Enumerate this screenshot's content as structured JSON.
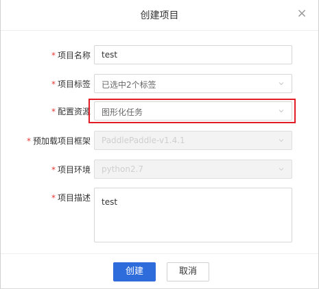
{
  "dialog": {
    "title": "创建项目",
    "close_icon": "close-icon",
    "close_glyph": "×"
  },
  "form": {
    "required_mark": "*",
    "name": {
      "label": "项目名称",
      "value": "test"
    },
    "tags": {
      "label": "项目标签",
      "value": "已选中2个标签"
    },
    "resource": {
      "label": "配置资源",
      "value": "图形化任务"
    },
    "framework": {
      "label": "预加载项目框架",
      "value": "PaddlePaddle-v1.4.1"
    },
    "environment": {
      "label": "项目环境",
      "value": "python2.7"
    },
    "description": {
      "label": "项目描述",
      "value": "test"
    }
  },
  "footer": {
    "create_label": "创建",
    "cancel_label": "取消"
  },
  "colors": {
    "primary": "#2f6cdb",
    "required": "#e53935",
    "highlight": "#e11c24"
  }
}
